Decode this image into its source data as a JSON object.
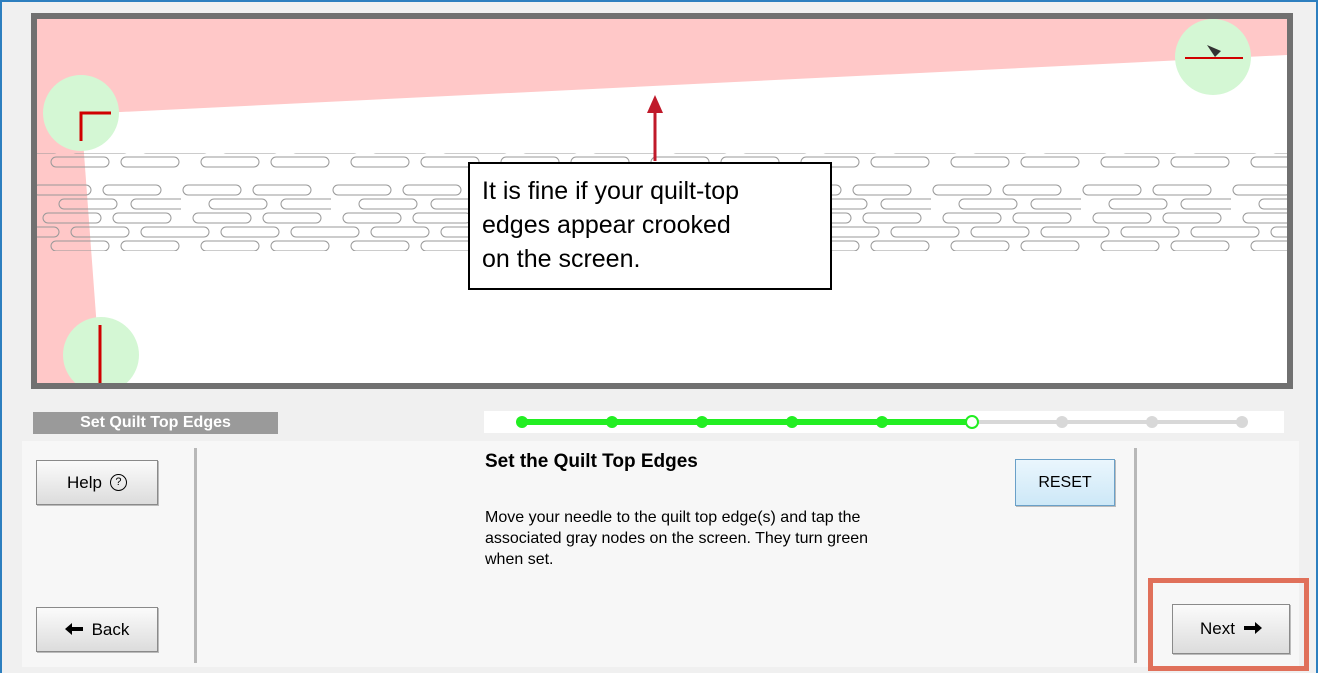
{
  "callout": {
    "line1": "It is fine if your quilt-top",
    "line2": "edges appear crooked",
    "line3": "on the screen."
  },
  "stage": {
    "label": "Set Quilt Top Edges"
  },
  "progress": {
    "total_steps": 9,
    "completed_steps": 5,
    "current_step": 6
  },
  "panel": {
    "title": "Set the Quilt Top Edges",
    "description": "Move your needle to the quilt top edge(s) and tap the associated gray nodes on the screen. They turn green when set."
  },
  "buttons": {
    "help": "Help",
    "help_icon": "?",
    "back": "Back",
    "next": "Next",
    "reset": "RESET"
  },
  "colors": {
    "progress_done": "#22ee22",
    "progress_todo": "#d8d8d8",
    "excluded_area": "#ffc8c8",
    "node_set": "#d4f7d4",
    "edge_marker": "#d00000",
    "highlight": "#e0705a"
  }
}
